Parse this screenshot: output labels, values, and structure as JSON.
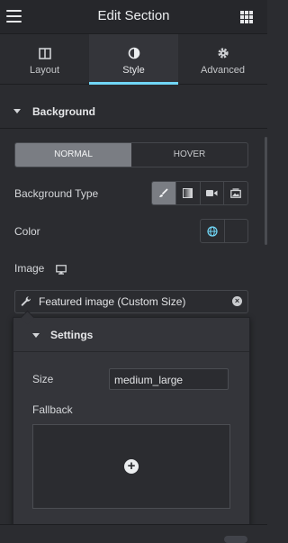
{
  "header": {
    "title": "Edit Section",
    "menu_icon": "hamburger-menu-icon",
    "apps_icon": "grid-apps-icon"
  },
  "tabs": [
    {
      "label": "Layout",
      "icon": "columns-layout-icon",
      "active": false
    },
    {
      "label": "Style",
      "icon": "half-circle-style-icon",
      "active": true
    },
    {
      "label": "Advanced",
      "icon": "gear-icon",
      "active": false
    }
  ],
  "section": {
    "title": "Background",
    "expanded": true
  },
  "state_switch": {
    "normal": "NORMAL",
    "hover": "HOVER",
    "selected": "NORMAL"
  },
  "background_type": {
    "label": "Background Type",
    "options": [
      "brush-classic-icon",
      "gradient-icon",
      "video-icon",
      "slideshow-icon"
    ],
    "selected": "brush-classic-icon"
  },
  "color": {
    "label": "Color",
    "globe_icon": "globe-icon"
  },
  "image": {
    "label": "Image",
    "device_icon": "desktop-monitor-icon",
    "dynamic_value": "Featured image (Custom Size)"
  },
  "settings_popup": {
    "title": "Settings",
    "size_label": "Size",
    "size_value": "medium_large",
    "fallback_label": "Fallback"
  },
  "colors": {
    "accent": "#71d7f7",
    "panel": "#2b2c30",
    "active_segment": "#7a7d83"
  }
}
